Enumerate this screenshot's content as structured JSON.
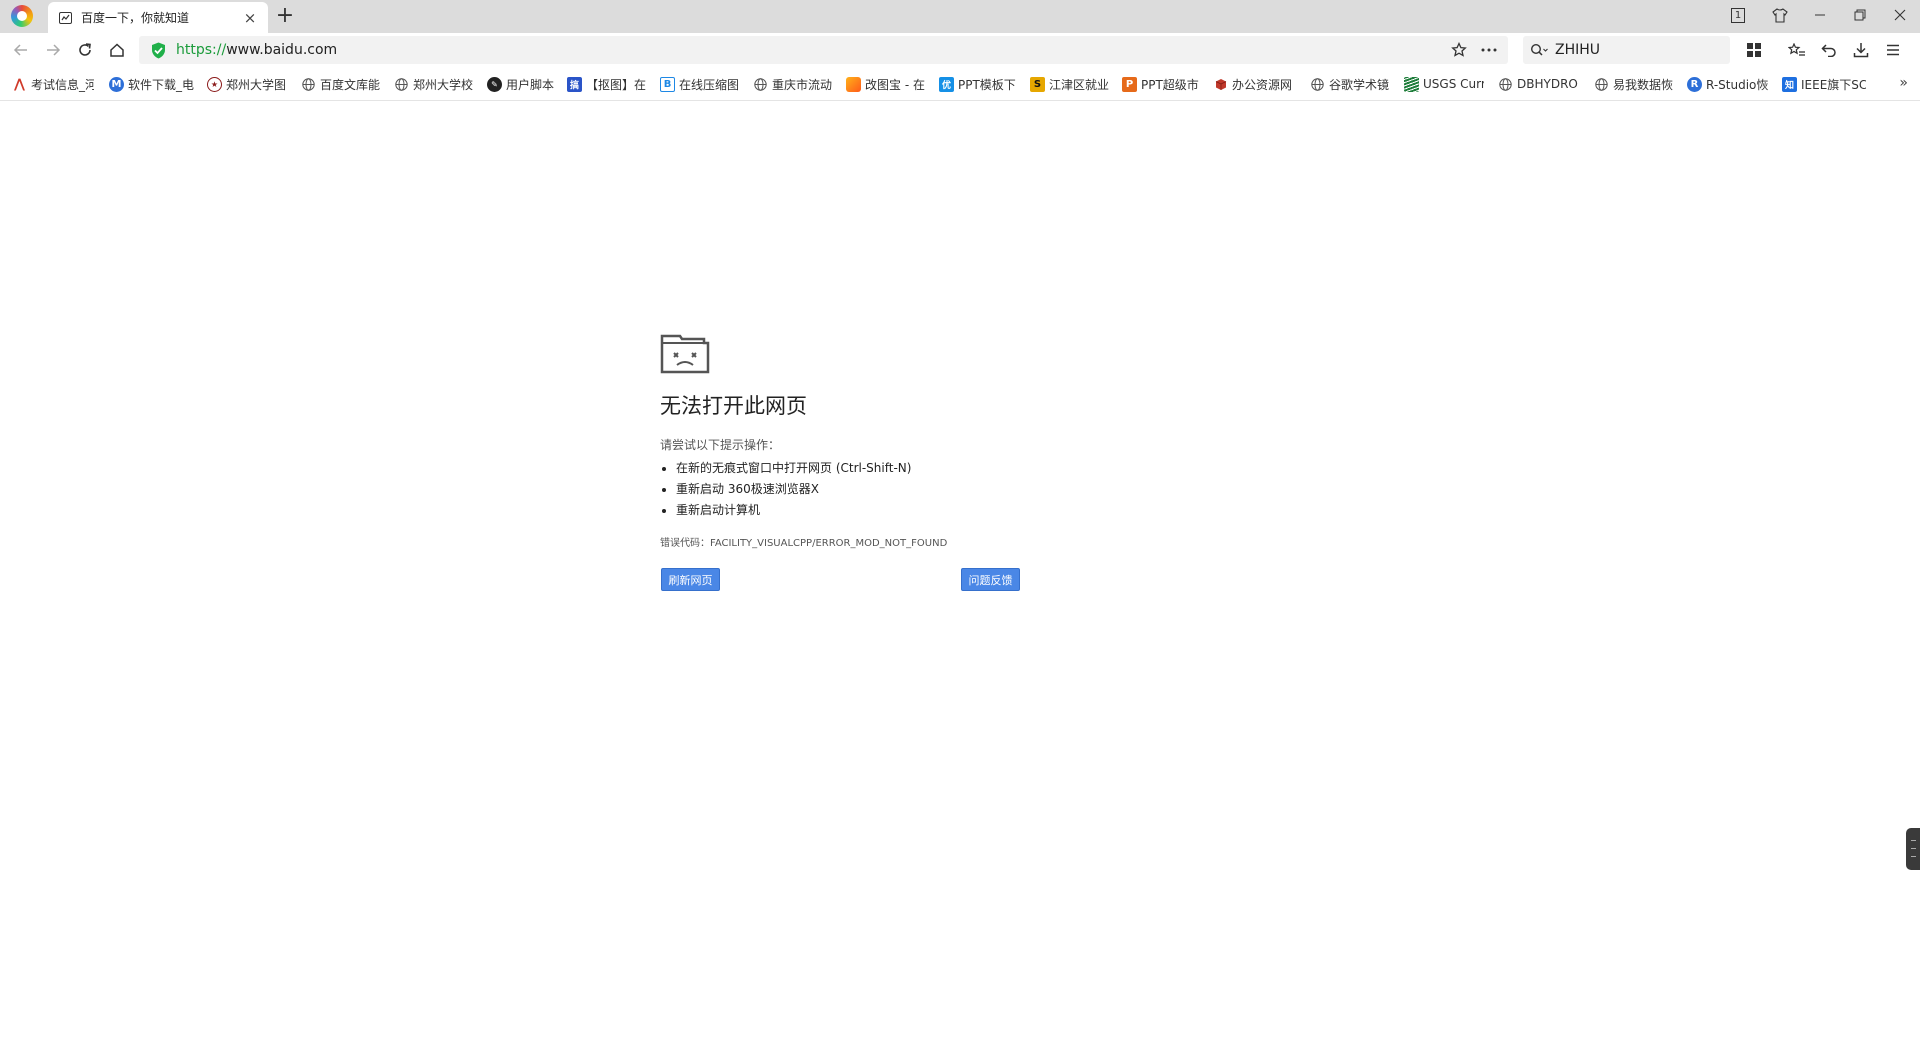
{
  "tab": {
    "title": "百度一下，你就知道",
    "close": "×"
  },
  "new_tab_label": "+",
  "window_controls": {
    "tab_count": "1"
  },
  "address": {
    "scheme": "https://",
    "host": "www.baidu.com"
  },
  "search": {
    "value": "ZHIHU"
  },
  "bookmarks": [
    {
      "label": "考试信息_河",
      "icon": "red-logo",
      "color": "#d03a2a"
    },
    {
      "label": "软件下载_电",
      "icon": "m-circle",
      "color": "#2d6fd8"
    },
    {
      "label": "郑州大学图",
      "icon": "seal",
      "color": "#8b1a1a"
    },
    {
      "label": "百度文库能",
      "icon": "globe",
      "color": "#666666"
    },
    {
      "label": "郑州大学校",
      "icon": "globe",
      "color": "#666666"
    },
    {
      "label": "用户脚本",
      "icon": "dark-circle",
      "color": "#222222"
    },
    {
      "label": "【抠图】在",
      "icon": "blue-square",
      "color": "#2a54c8"
    },
    {
      "label": "在线压缩图",
      "icon": "b-square",
      "color": "#1e88e5"
    },
    {
      "label": "重庆市流动",
      "icon": "globe",
      "color": "#666666"
    },
    {
      "label": "改图宝 - 在",
      "icon": "orange-square",
      "color": "#ff7a1a"
    },
    {
      "label": "PPT模板下",
      "icon": "you-square",
      "color": "#1590e6"
    },
    {
      "label": "江津区就业",
      "icon": "s-square",
      "color": "#e6a700"
    },
    {
      "label": "PPT超级市",
      "icon": "p-square",
      "color": "#e66a1a"
    },
    {
      "label": "办公资源网",
      "icon": "cube",
      "color": "#c0392b"
    },
    {
      "label": "谷歌学术镜",
      "icon": "globe",
      "color": "#666666"
    },
    {
      "label": "USGS Curr",
      "icon": "usgs",
      "color": "#1e7d3a"
    },
    {
      "label": "DBHYDRO",
      "icon": "globe",
      "color": "#666666"
    },
    {
      "label": "易我数据恢",
      "icon": "globe",
      "color": "#666666"
    },
    {
      "label": "R-Studio恢",
      "icon": "r-circle",
      "color": "#2d6fd8"
    },
    {
      "label": "IEEE旗下SC",
      "icon": "zhi-square",
      "color": "#1e6fe0"
    }
  ],
  "bookmarks_overflow": "»",
  "error": {
    "title": "无法打开此网页",
    "hint": "请尝试以下提示操作：",
    "suggestions": [
      "在新的无痕式窗口中打开网页 (Ctrl-Shift-N)",
      "重新启动 360极速浏览器X",
      "重新启动计算机"
    ],
    "code_label": "错误代码：",
    "code": "FACILITY_VISUALCPP/ERROR_MOD_NOT_FOUND",
    "refresh_button": "刷新网页",
    "feedback_button": "问题反馈"
  }
}
